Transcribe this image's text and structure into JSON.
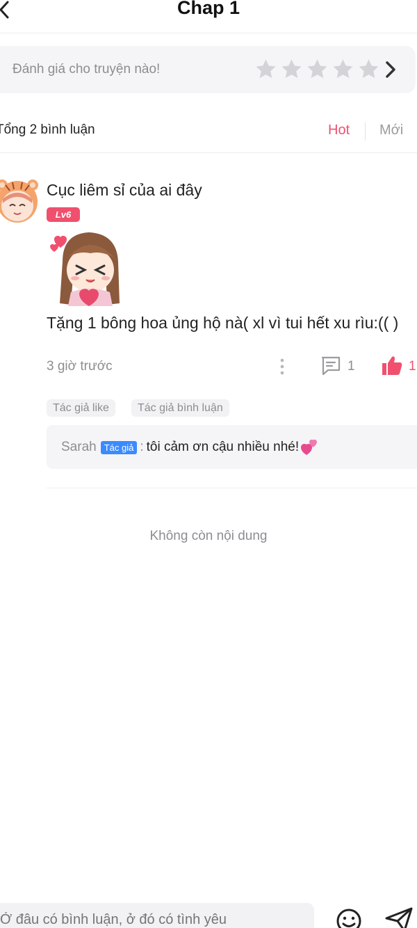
{
  "header": {
    "title": "Chap 1",
    "back_icon": "chevron-left-icon"
  },
  "rating": {
    "prompt": "Đánh giá cho truyện nào!",
    "stars_total": 5,
    "stars_selected": 0,
    "star_color": "#d4d4d8",
    "arrow_icon": "chevron-right-icon"
  },
  "comments_header": {
    "count_text": "Tổng 2 bình luận",
    "sort_hot": "Hot",
    "sort_new": "Mới",
    "active_color": "#f0506e"
  },
  "comment": {
    "username": "Cục liêm sỉ của ai đây",
    "level": "Lv6",
    "text": "Tặng 1 bông hoa ủng  hộ nà( xl vì tui hết xu rìu:(( )",
    "time": "3 giờ trước",
    "reply_count": "1",
    "like_count": "1",
    "tags": [
      "Tác giả like",
      "Tác giả bình luận"
    ],
    "reply": {
      "author": "Sarah",
      "badge": "Tác giả",
      "separator": ":",
      "text": "tôi cảm ơn cậu nhiều nhé!"
    }
  },
  "footer_note": "Không còn nội dung",
  "composer": {
    "placeholder": "Ở đâu có bình luận, ở đó có tình yêu",
    "emoji_icon": "smile-icon",
    "send_icon": "send-icon"
  }
}
